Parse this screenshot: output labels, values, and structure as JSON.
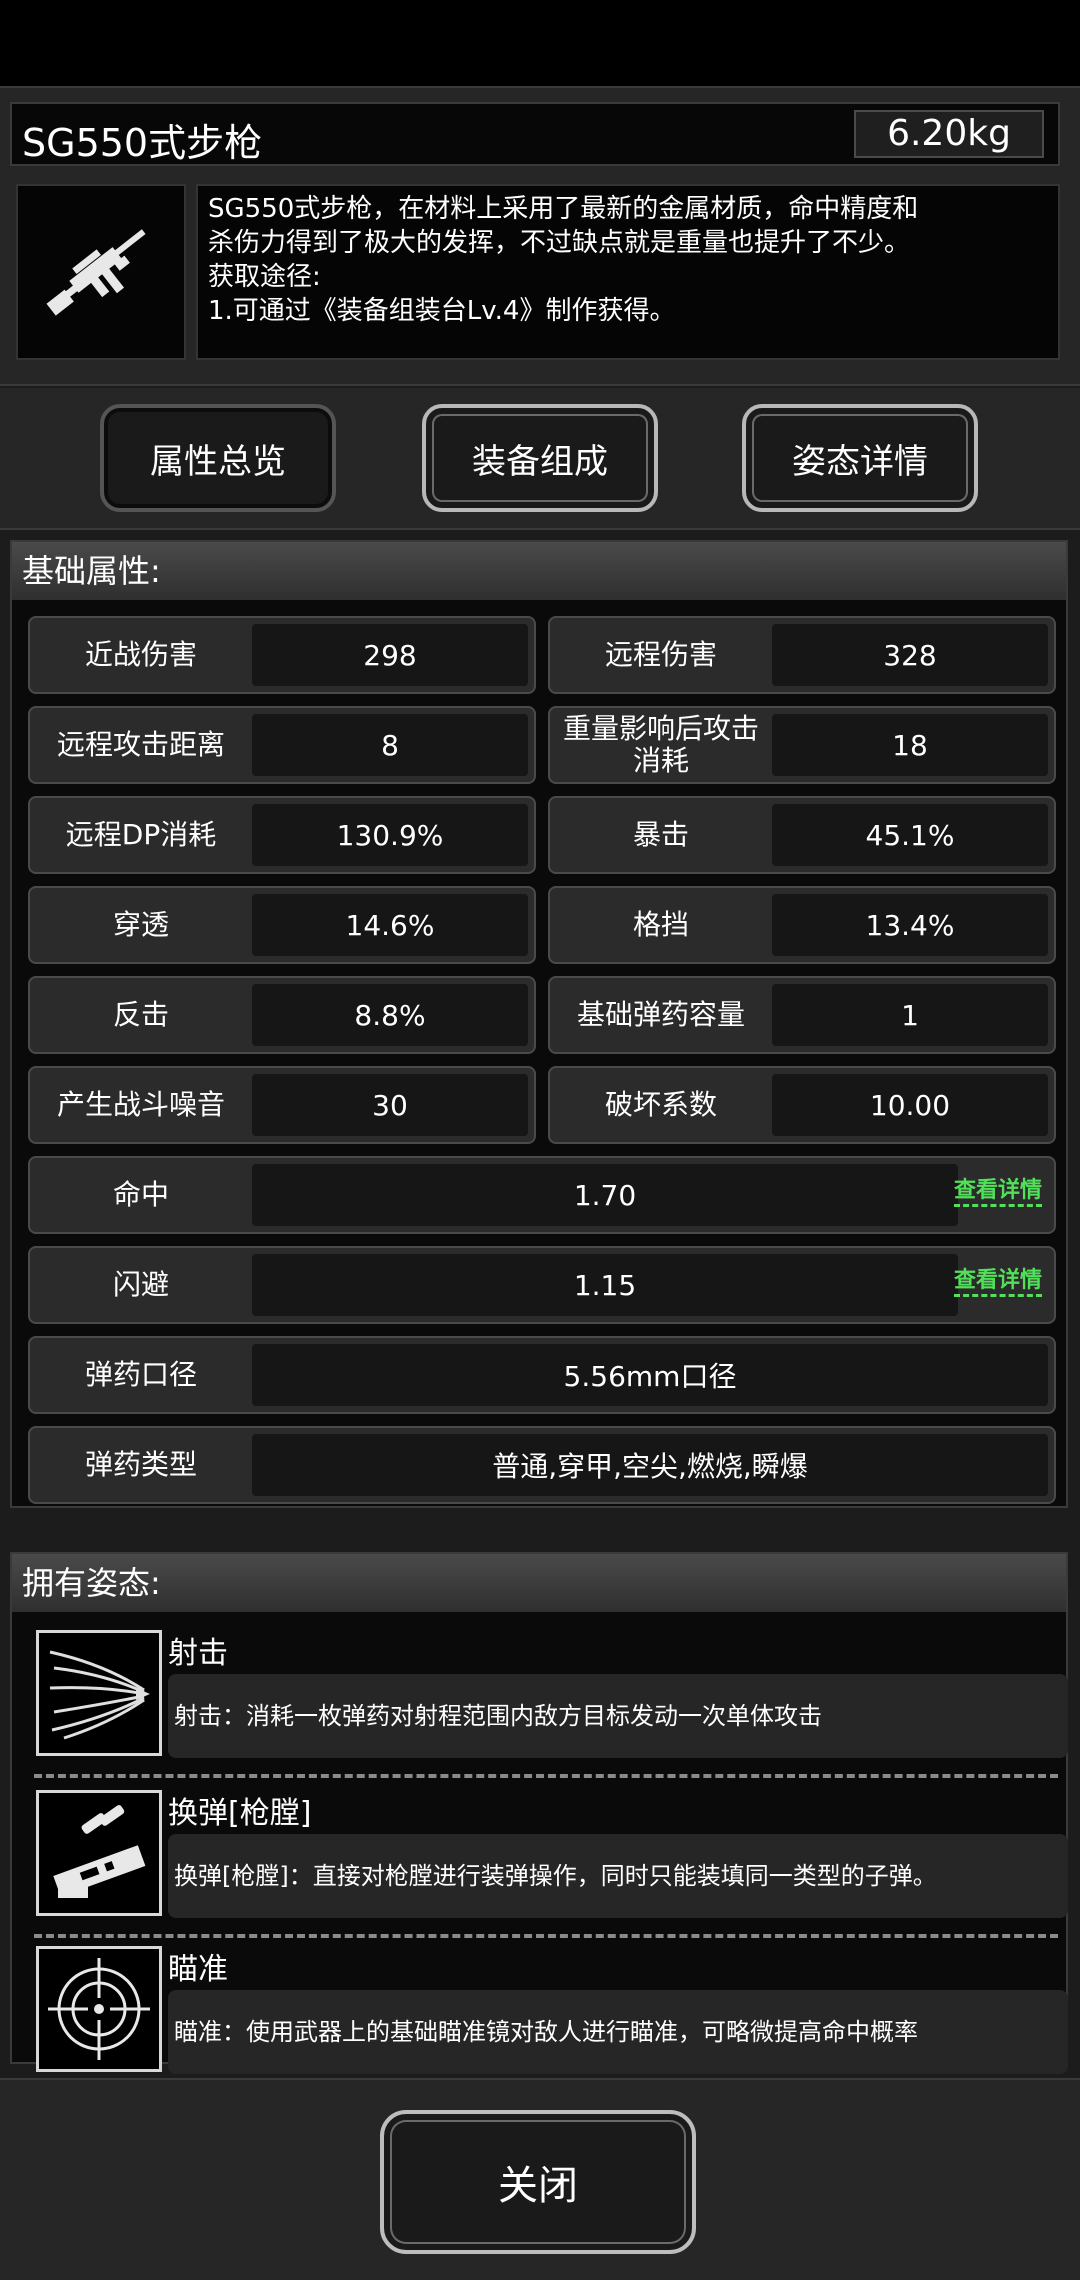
{
  "item": {
    "name": "SG550式步枪",
    "weight": "6.20kg",
    "description_lines": [
      "SG550式步枪，在材料上采用了最新的金属材质，命中精度和",
      "杀伤力得到了极大的发挥，不过缺点就是重量也提升了不少。",
      "获取途径:",
      "1.可通过《装备组装台Lv.4》制作获得。"
    ]
  },
  "tabs": [
    {
      "label": "属性总览"
    },
    {
      "label": "装备组成"
    },
    {
      "label": "姿态详情"
    }
  ],
  "basic": {
    "title": "基础属性:",
    "stats": [
      {
        "label": "近战伤害",
        "value": "298"
      },
      {
        "label": "远程伤害",
        "value": "328"
      },
      {
        "label": "远程攻击距离",
        "value": "8"
      },
      {
        "label": "重量影响后攻击消耗",
        "value": "18"
      },
      {
        "label": "远程DP消耗",
        "value": "130.9%"
      },
      {
        "label": "暴击",
        "value": "45.1%"
      },
      {
        "label": "穿透",
        "value": "14.6%"
      },
      {
        "label": "格挡",
        "value": "13.4%"
      },
      {
        "label": "反击",
        "value": "8.8%"
      },
      {
        "label": "基础弹药容量",
        "value": "1"
      },
      {
        "label": "产生战斗噪音",
        "value": "30"
      },
      {
        "label": "破坏系数",
        "value": "10.00"
      }
    ],
    "wide": [
      {
        "label": "命中",
        "value": "1.70",
        "link": "查看详情"
      },
      {
        "label": "闪避",
        "value": "1.15",
        "link": "查看详情"
      },
      {
        "label": "弹药口径",
        "value": "5.56mm口径"
      },
      {
        "label": "弹药类型",
        "value": "普通,穿甲,空尖,燃烧,瞬爆"
      }
    ]
  },
  "postures": {
    "title": "拥有姿态:",
    "items": [
      {
        "name": "射击",
        "description": "射击：消耗一枚弹药对射程范围内敌方目标发动一次单体攻击",
        "icon": "bullet-streaks-icon"
      },
      {
        "name": "换弹[枪膛]",
        "description": "换弹[枪膛]：直接对枪膛进行装弹操作，同时只能装填同一类型的子弹。",
        "icon": "reload-icon"
      },
      {
        "name": "瞄准",
        "description": "瞄准：使用武器上的基础瞄准镜对敌人进行瞄准，可略微提高命中概率",
        "icon": "crosshair-icon"
      }
    ]
  },
  "footer": {
    "close_label": "关闭"
  }
}
